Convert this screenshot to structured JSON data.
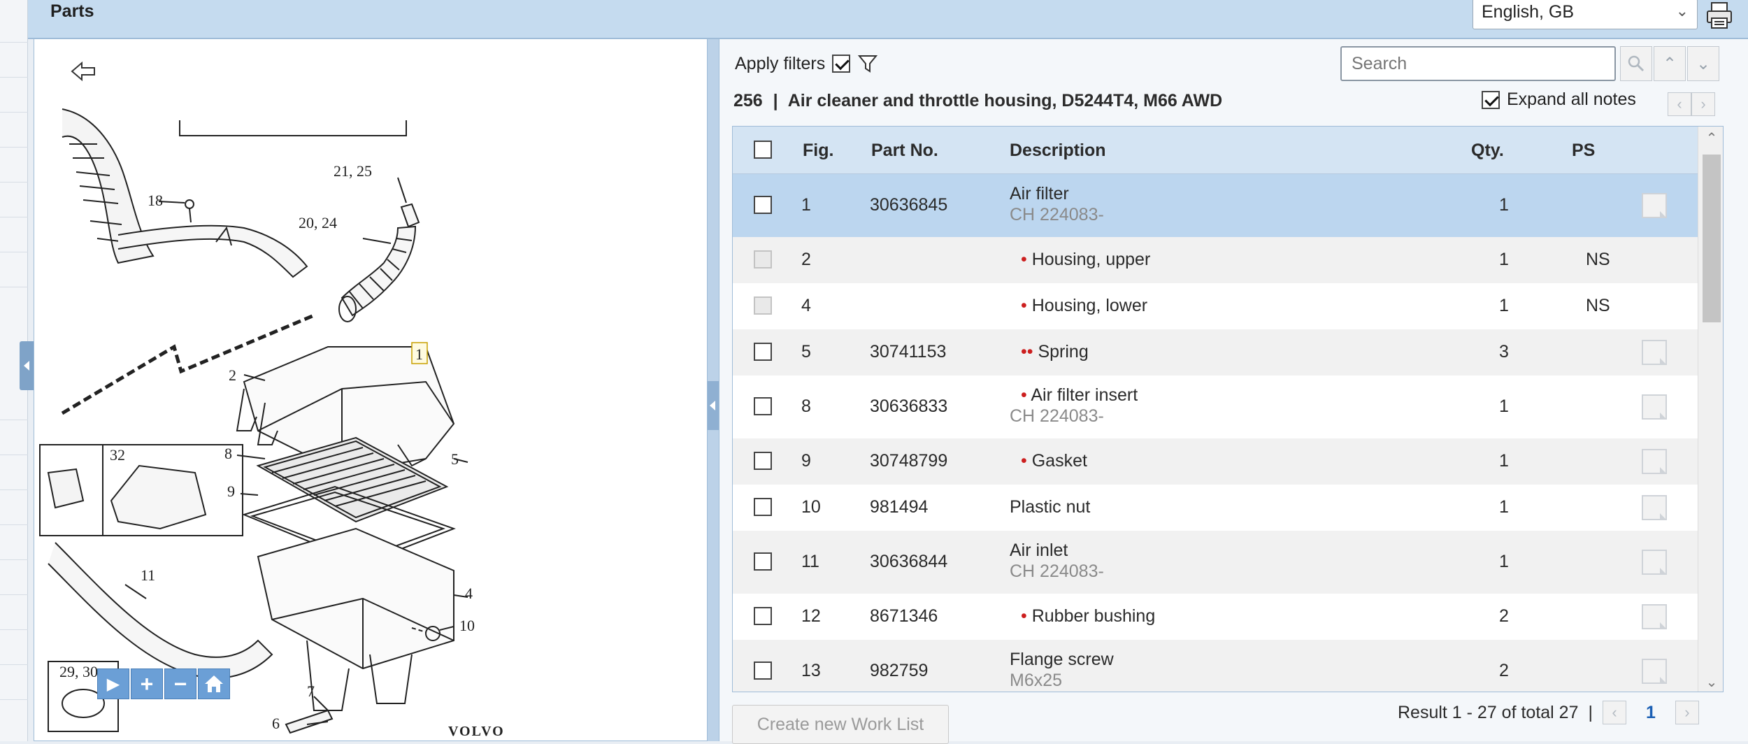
{
  "header": {
    "title": "Parts",
    "language": "English, GB",
    "print_icon": "printer-icon"
  },
  "diagram": {
    "back_icon": "back-arrow-icon",
    "callouts": [
      "18",
      "21, 25",
      "20, 24",
      "1",
      "2",
      "8",
      "9",
      "5",
      "32",
      "11",
      "4",
      "10",
      "29, 30",
      "7",
      "6"
    ],
    "brand": "VOLVO",
    "zoom_controls": [
      "play-icon",
      "zoom-in-icon",
      "zoom-out-icon",
      "home-icon"
    ]
  },
  "parts": {
    "apply_filters_label": "Apply filters",
    "apply_filters_checked": true,
    "search_placeholder": "Search",
    "section_number": "256",
    "section_separator": "|",
    "section_title": "Air cleaner and throttle housing, D5244T4, M66 AWD",
    "expand_notes_label": "Expand all notes",
    "columns": {
      "fig": "Fig.",
      "part_no": "Part No.",
      "description": "Description",
      "qty": "Qty.",
      "ps": "PS"
    },
    "rows": [
      {
        "fig": "1",
        "part_no": "30636845",
        "dots": "",
        "description": "Air filter",
        "sub": "CH 224083-",
        "qty": "1",
        "ps": "",
        "note": true
      },
      {
        "fig": "2",
        "part_no": "",
        "dots": "•",
        "description": "Housing, upper",
        "sub": "",
        "qty": "1",
        "ps": "NS",
        "note": false
      },
      {
        "fig": "4",
        "part_no": "",
        "dots": "•",
        "description": "Housing, lower",
        "sub": "",
        "qty": "1",
        "ps": "NS",
        "note": false
      },
      {
        "fig": "5",
        "part_no": "30741153",
        "dots": "••",
        "description": "Spring",
        "sub": "",
        "qty": "3",
        "ps": "",
        "note": true
      },
      {
        "fig": "8",
        "part_no": "30636833",
        "dots": "•",
        "description": "Air filter insert",
        "sub": "CH 224083-",
        "qty": "1",
        "ps": "",
        "note": true
      },
      {
        "fig": "9",
        "part_no": "30748799",
        "dots": "•",
        "description": "Gasket",
        "sub": "",
        "qty": "1",
        "ps": "",
        "note": true
      },
      {
        "fig": "10",
        "part_no": "981494",
        "dots": "",
        "description": "Plastic nut",
        "sub": "",
        "qty": "1",
        "ps": "",
        "note": true
      },
      {
        "fig": "11",
        "part_no": "30636844",
        "dots": "",
        "description": "Air inlet",
        "sub": "CH 224083-",
        "qty": "1",
        "ps": "",
        "note": true
      },
      {
        "fig": "12",
        "part_no": "8671346",
        "dots": "•",
        "description": "Rubber bushing",
        "sub": "",
        "qty": "2",
        "ps": "",
        "note": true
      },
      {
        "fig": "13",
        "part_no": "982759",
        "dots": "",
        "description": "Flange screw",
        "sub": "M6x25",
        "qty": "2",
        "ps": "",
        "note": true
      }
    ],
    "create_worklist_label": "Create new Work List",
    "result_text": "Result 1 - 27 of total 27",
    "page_separator": "|",
    "current_page": "1"
  }
}
